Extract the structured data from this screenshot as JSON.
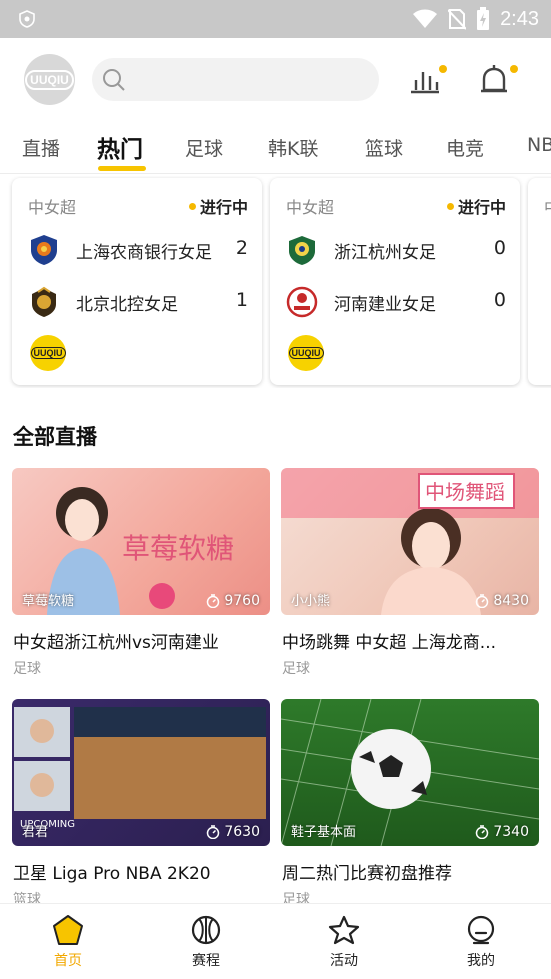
{
  "status_bar": {
    "time": "2:43"
  },
  "header": {
    "logo_text": "UUQIU",
    "search_placeholder": ""
  },
  "tabs": [
    {
      "label": "直播"
    },
    {
      "label": "热门"
    },
    {
      "label": "足球"
    },
    {
      "label": "韩K联"
    },
    {
      "label": "篮球"
    },
    {
      "label": "电竞"
    },
    {
      "label": "NBA"
    }
  ],
  "matches": [
    {
      "league": "中女超",
      "status": "进行中",
      "home": {
        "name": "上海农商银行女足",
        "score": "2"
      },
      "away": {
        "name": "北京北控女足",
        "score": "1"
      },
      "badge": "UUQIU"
    },
    {
      "league": "中女超",
      "status": "进行中",
      "home": {
        "name": "浙江杭州女足",
        "score": "0"
      },
      "away": {
        "name": "河南建业女足",
        "score": "0"
      },
      "badge": "UUQIU"
    },
    {
      "league": "中"
    }
  ],
  "section_title": "全部直播",
  "live_streams": [
    {
      "streamer": "草莓软糖",
      "views": "9760",
      "title": "中女超浙江杭州vs河南建业",
      "category": "足球",
      "overlay_text": "草莓软糖"
    },
    {
      "streamer": "小小熊",
      "views": "8430",
      "title": "中场跳舞 中女超 上海龙商...",
      "category": "足球",
      "overlay_text": "中场舞蹈"
    },
    {
      "streamer": "君君",
      "views": "7630",
      "title": "卫星 Liga Pro NBA 2K20",
      "category": "篮球",
      "overlay_text": "UPCOMING"
    },
    {
      "streamer": "鞋子基本面",
      "views": "7340",
      "title": "周二热门比赛初盘推荐",
      "category": "足球",
      "overlay_text": ""
    }
  ],
  "bottom_nav": [
    {
      "label": "首页",
      "icon": "home-icon"
    },
    {
      "label": "赛程",
      "icon": "basketball-icon"
    },
    {
      "label": "活动",
      "icon": "star-icon"
    },
    {
      "label": "我的",
      "icon": "profile-icon"
    }
  ],
  "colors": {
    "accent": "#f7c400",
    "live_dot": "#f5b800",
    "nav_active": "#f2a800",
    "status_bar": "#c8c8c8"
  }
}
